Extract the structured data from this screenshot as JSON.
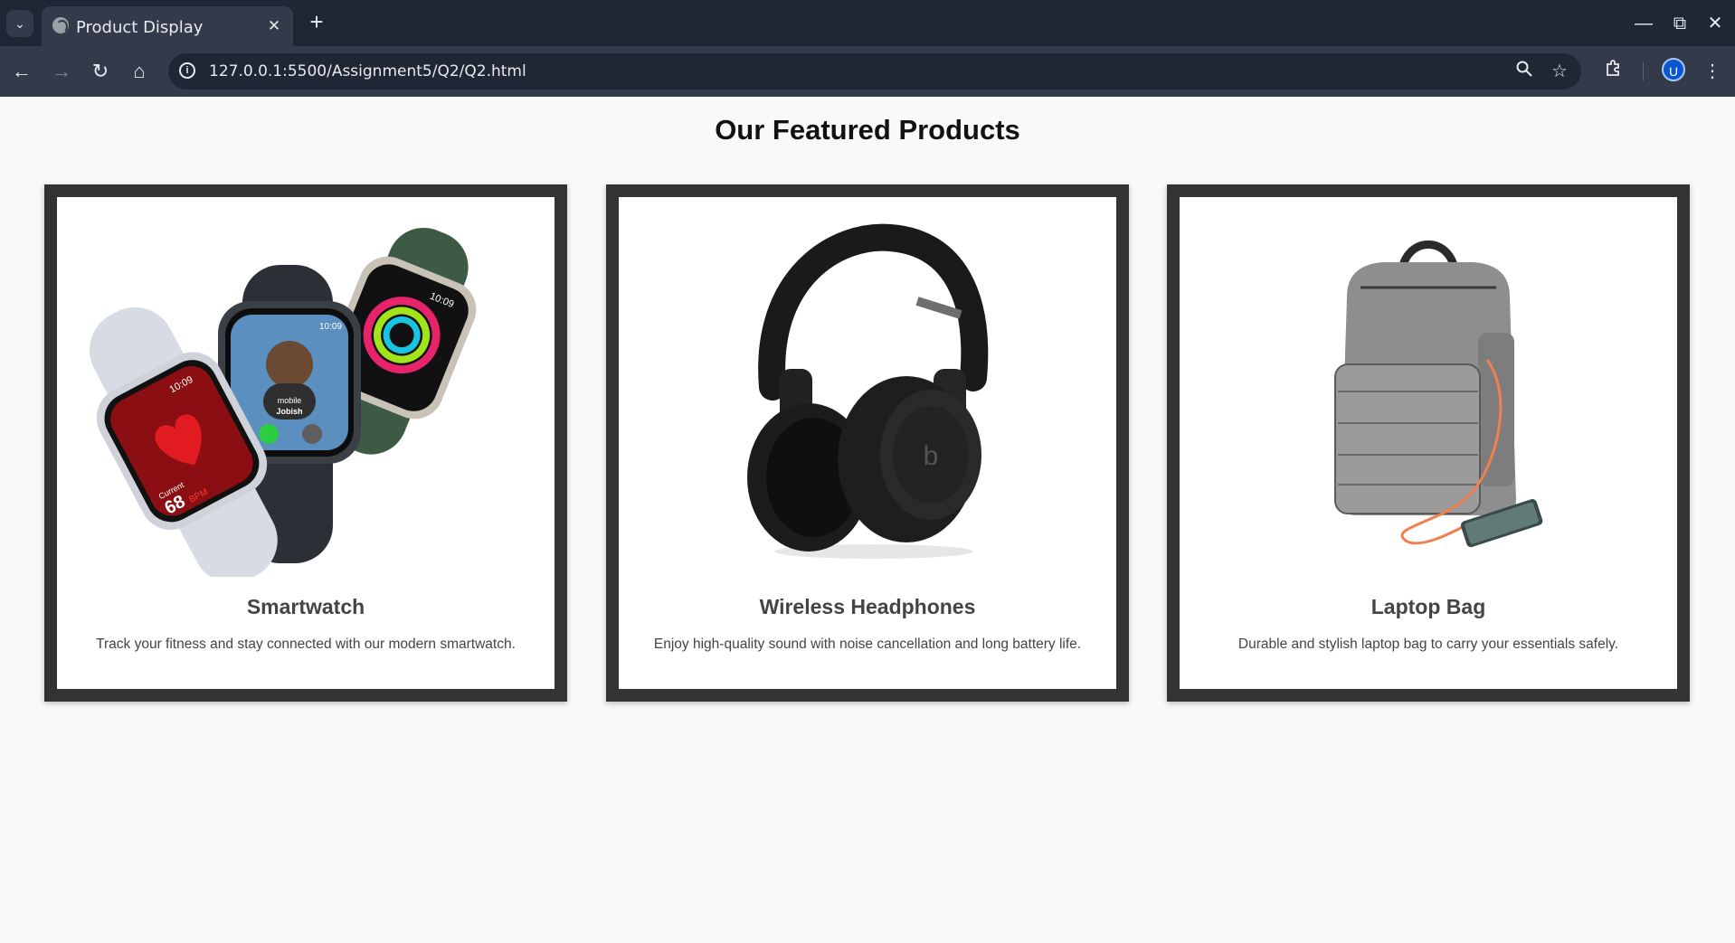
{
  "browser": {
    "tab_title": "Product Display",
    "url": "127.0.0.1:5500/Assignment5/Q2/Q2.html",
    "profile_initial": "U"
  },
  "page": {
    "heading": "Our Featured Products"
  },
  "products": [
    {
      "name": "Smartwatch",
      "description": "Track your fitness and stay connected with our modern smartwatch.",
      "image_icon": "smartwatch-image",
      "watch_text": {
        "time": "10:09",
        "reading": "68",
        "unit": "BPM",
        "label": "Current",
        "caller_top": "mobile",
        "caller": "Jobish"
      }
    },
    {
      "name": "Wireless Headphones",
      "description": "Enjoy high-quality sound with noise cancellation and long battery life.",
      "image_icon": "headphones-image"
    },
    {
      "name": "Laptop Bag",
      "description": "Durable and stylish laptop bag to carry your essentials safely.",
      "image_icon": "backpack-image"
    }
  ],
  "colors": {
    "card_border": "#333333",
    "page_bg": "#f8f9fa",
    "chrome_bg": "#1f2634"
  }
}
